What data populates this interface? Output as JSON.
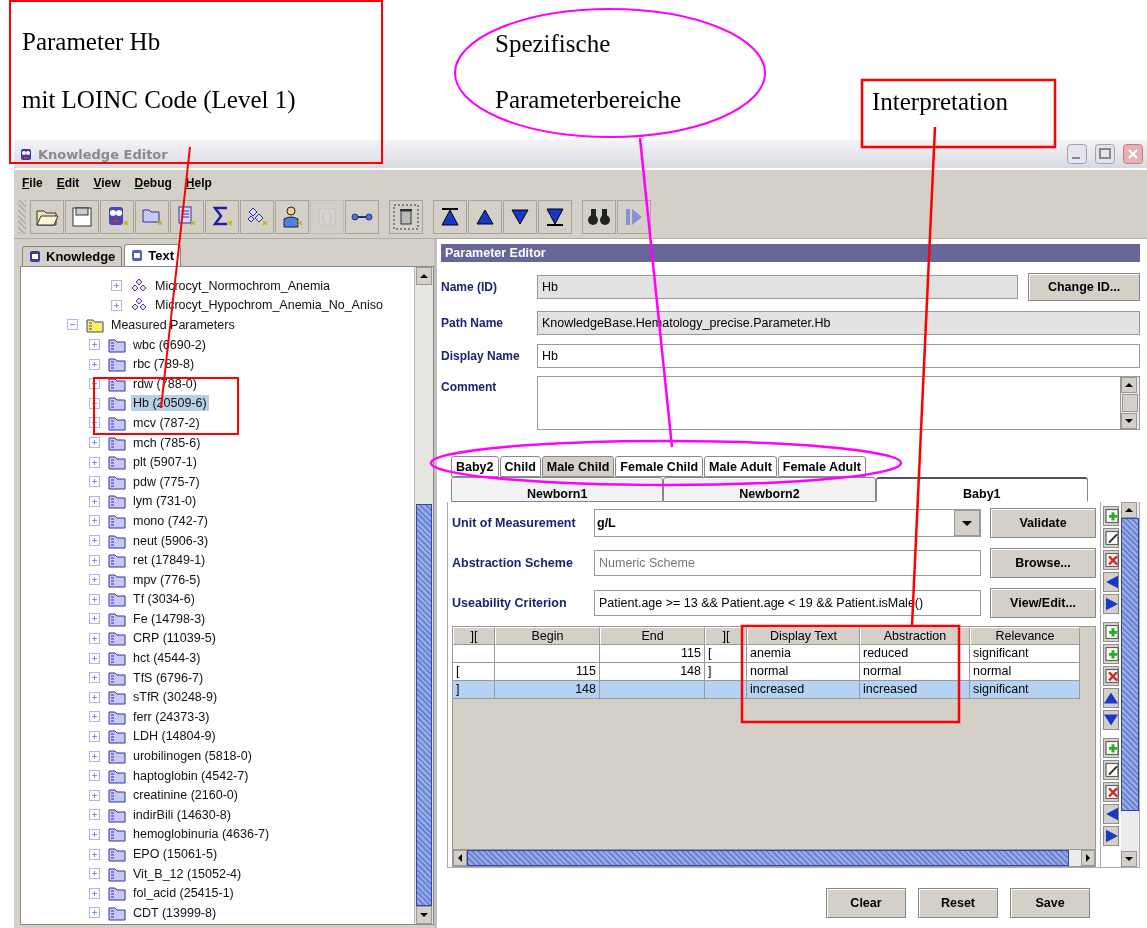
{
  "annotations": [
    {
      "kind": "box",
      "lines": [
        "Parameter Hb",
        "mit LOINC Code (Level 1)"
      ]
    },
    {
      "kind": "ellipse",
      "lines": [
        "Spezifische",
        "Parameterbereiche"
      ]
    },
    {
      "kind": "box",
      "lines": [
        "Interpretation"
      ]
    }
  ],
  "window": {
    "title": "Knowledge Editor"
  },
  "menu": [
    {
      "label": "File"
    },
    {
      "label": "Edit"
    },
    {
      "label": "View"
    },
    {
      "label": "Debug"
    },
    {
      "label": "Help"
    }
  ],
  "toolbar": [
    [
      {
        "kind": "open",
        "disabled": false
      },
      {
        "kind": "save",
        "disabled": false
      },
      {
        "kind": "owl",
        "disabled": false
      },
      {
        "kind": "folder",
        "disabled": false
      },
      {
        "kind": "document",
        "disabled": false
      },
      {
        "kind": "sum",
        "disabled": false
      },
      {
        "kind": "diagnosis",
        "disabled": false
      },
      {
        "kind": "person",
        "disabled": false
      },
      {
        "kind": "braces",
        "disabled": true
      },
      {
        "kind": "link",
        "disabled": false
      }
    ],
    [
      {
        "kind": "trash",
        "disabled": false
      }
    ],
    [
      {
        "kind": "first",
        "disabled": false
      },
      {
        "kind": "up",
        "disabled": false
      },
      {
        "kind": "down",
        "disabled": false
      },
      {
        "kind": "last",
        "disabled": false
      }
    ],
    [
      {
        "kind": "find",
        "disabled": false
      },
      {
        "kind": "step",
        "disabled": false
      }
    ]
  ],
  "left_tabs": [
    {
      "label": "Knowledge",
      "selected": false
    },
    {
      "label": "Text",
      "selected": true
    }
  ],
  "tree": [
    {
      "children": [
        {
          "children": [
            {
              "label": "Microcyt_Normochrom_Anemia",
              "kind": "diagnosis",
              "expanded": false,
              "selected": false
            },
            {
              "label": "Microcyt_Hypochrom_Anemia_No_Aniso",
              "kind": "diagnosis",
              "expanded": false,
              "selected": false
            }
          ]
        }
      ]
    },
    {
      "label": "Measured Parameters",
      "kind": "group",
      "expanded": true,
      "selected": false,
      "children": [
        {
          "label": "wbc (6690-2)",
          "kind": "parameter",
          "expanded": false,
          "selected": false
        },
        {
          "label": "rbc (789-8)",
          "kind": "parameter",
          "expanded": false,
          "selected": false
        },
        {
          "label": "rdw (788-0)",
          "kind": "parameter",
          "expanded": false,
          "selected": false
        },
        {
          "label": "Hb (20509-6)",
          "kind": "parameter",
          "expanded": false,
          "selected": true
        },
        {
          "label": "mcv (787-2)",
          "kind": "parameter",
          "expanded": false,
          "selected": false
        },
        {
          "label": "mch (785-6)",
          "kind": "parameter",
          "expanded": false,
          "selected": false
        },
        {
          "label": "plt (5907-1)",
          "kind": "parameter",
          "expanded": false,
          "selected": false
        },
        {
          "label": "pdw (775-7)",
          "kind": "parameter",
          "expanded": false,
          "selected": false
        },
        {
          "label": "lym (731-0)",
          "kind": "parameter",
          "expanded": false,
          "selected": false
        },
        {
          "label": "mono (742-7)",
          "kind": "parameter",
          "expanded": false,
          "selected": false
        },
        {
          "label": "neut (5906-3)",
          "kind": "parameter",
          "expanded": false,
          "selected": false
        },
        {
          "label": "ret (17849-1)",
          "kind": "parameter",
          "expanded": false,
          "selected": false
        },
        {
          "label": "mpv (776-5)",
          "kind": "parameter",
          "expanded": false,
          "selected": false
        },
        {
          "label": "Tf (3034-6)",
          "kind": "parameter",
          "expanded": false,
          "selected": false
        },
        {
          "label": "Fe (14798-3)",
          "kind": "parameter",
          "expanded": false,
          "selected": false
        },
        {
          "label": "CRP (11039-5)",
          "kind": "parameter",
          "expanded": false,
          "selected": false
        },
        {
          "label": "hct (4544-3)",
          "kind": "parameter",
          "expanded": false,
          "selected": false
        },
        {
          "label": "TfS (6796-7)",
          "kind": "parameter",
          "expanded": false,
          "selected": false
        },
        {
          "label": "sTfR (30248-9)",
          "kind": "parameter",
          "expanded": false,
          "selected": false
        },
        {
          "label": "ferr (24373-3)",
          "kind": "parameter",
          "expanded": false,
          "selected": false
        },
        {
          "label": "LDH (14804-9)",
          "kind": "parameter",
          "expanded": false,
          "selected": false
        },
        {
          "label": "urobilinogen (5818-0)",
          "kind": "parameter",
          "expanded": false,
          "selected": false
        },
        {
          "label": "haptoglobin (4542-7)",
          "kind": "parameter",
          "expanded": false,
          "selected": false
        },
        {
          "label": "creatinine (2160-0)",
          "kind": "parameter",
          "expanded": false,
          "selected": false
        },
        {
          "label": "indirBili (14630-8)",
          "kind": "parameter",
          "expanded": false,
          "selected": false
        },
        {
          "label": "hemoglobinuria (4636-7)",
          "kind": "parameter",
          "expanded": false,
          "selected": false
        },
        {
          "label": "EPO (15061-5)",
          "kind": "parameter",
          "expanded": false,
          "selected": false
        },
        {
          "label": "Vit_B_12 (15052-4)",
          "kind": "parameter",
          "expanded": false,
          "selected": false
        },
        {
          "label": "fol_acid (25415-1)",
          "kind": "parameter",
          "expanded": false,
          "selected": false
        },
        {
          "label": "CDT (13999-8)",
          "kind": "parameter",
          "expanded": false,
          "selected": false
        }
      ]
    }
  ],
  "editor": {
    "title": "Parameter Editor",
    "name_id": {
      "label": "Name (ID)",
      "value": "Hb",
      "button": "Change ID..."
    },
    "path_name": {
      "label": "Path Name",
      "value": "KnowledgeBase.Hematology_precise.Parameter.Hb"
    },
    "display_name": {
      "label": "Display Name",
      "value": "Hb"
    },
    "comment": {
      "label": "Comment"
    },
    "tab_rows": [
      [
        {
          "label": "Baby2",
          "selected": false,
          "highlighted": false
        },
        {
          "label": "Child",
          "selected": false,
          "highlighted": false
        },
        {
          "label": "Male Child",
          "selected": false,
          "highlighted": true
        },
        {
          "label": "Female Child",
          "selected": false,
          "highlighted": false
        },
        {
          "label": "Male Adult",
          "selected": false,
          "highlighted": false
        },
        {
          "label": "Female Adult",
          "selected": false,
          "highlighted": false
        }
      ],
      [
        {
          "label": "Newborn1",
          "selected": false,
          "highlighted": false
        },
        {
          "label": "Newborn2",
          "selected": false,
          "highlighted": false
        },
        {
          "label": "Baby1",
          "selected": true,
          "highlighted": false
        }
      ]
    ],
    "unit": {
      "label": "Unit of Measurement",
      "value": "g/L",
      "button": "Validate"
    },
    "scheme": {
      "label": "Abstraction Scheme",
      "value": "Numeric Scheme",
      "button": "Browse..."
    },
    "criterion": {
      "label": "Useability Criterion",
      "value": "Patient.age >= 13 && Patient.age < 19 && Patient.isMale()",
      "button": "View/Edit..."
    },
    "table": {
      "columns": [
        "][",
        "Begin",
        "End",
        "][",
        "Display Text",
        "Abstraction",
        "Relevance"
      ],
      "rows": [
        {
          "cells": [
            null,
            null,
            "115",
            "[",
            "anemia",
            "reduced",
            "significant"
          ],
          "selected": false
        },
        {
          "cells": [
            "[",
            "115",
            "148",
            "]",
            "normal",
            "normal",
            "normal"
          ],
          "selected": false
        },
        {
          "cells": [
            "]",
            "148",
            null,
            null,
            "increased",
            "increased",
            "significant"
          ],
          "selected": true
        }
      ]
    },
    "side_tools": [
      [
        {
          "kind": "add"
        },
        {
          "kind": "edit"
        },
        {
          "kind": "delete"
        },
        {
          "kind": "left"
        },
        {
          "kind": "right"
        }
      ],
      [
        {
          "kind": "add"
        },
        {
          "kind": "add"
        },
        {
          "kind": "delete"
        },
        {
          "kind": "up"
        },
        {
          "kind": "down"
        }
      ],
      [
        {
          "kind": "add"
        },
        {
          "kind": "edit"
        },
        {
          "kind": "delete"
        },
        {
          "kind": "left"
        },
        {
          "kind": "right"
        }
      ]
    ],
    "buttons": [
      "Clear",
      "Reset",
      "Save"
    ]
  }
}
